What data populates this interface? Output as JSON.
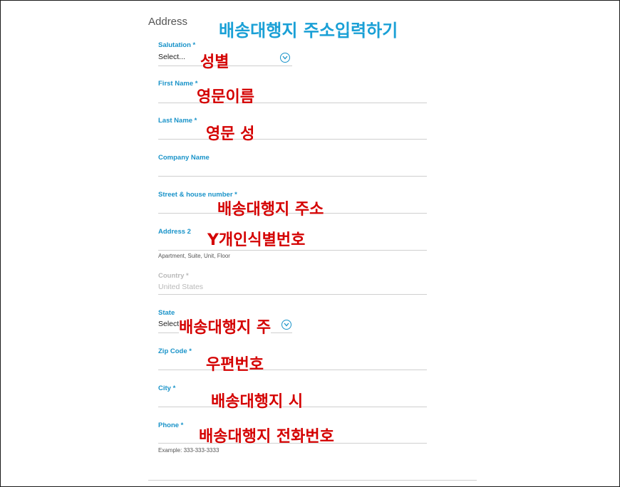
{
  "section": {
    "title": "Address",
    "heading_annotation": "배송대행지 주소입력하기"
  },
  "fields": {
    "salutation": {
      "label": "Salutation *",
      "value": "Select...",
      "annotation": "성별"
    },
    "first_name": {
      "label": "First Name *",
      "annotation": "영문이름"
    },
    "last_name": {
      "label": "Last Name *",
      "annotation": "영문 성"
    },
    "company": {
      "label": "Company Name"
    },
    "street": {
      "label": "Street & house number *",
      "annotation": "배송대행지 주소"
    },
    "address2": {
      "label": "Address 2",
      "annotation": "Y개인식별번호",
      "help": "Apartment, Suite, Unit, Floor"
    },
    "country": {
      "label": "Country *",
      "value": "United States"
    },
    "state": {
      "label": "State",
      "value": "Select",
      "annotation": "배송대행지 주"
    },
    "zip": {
      "label": "Zip Code *",
      "annotation": "우편번호"
    },
    "city": {
      "label": "City *",
      "annotation": "배송대행지 시"
    },
    "phone": {
      "label": "Phone *",
      "annotation": "배송대행지 전화번호",
      "help": "Example: 333-333-3333"
    }
  },
  "colors": {
    "label": "#1993c9",
    "annotation_red": "#d40000",
    "annotation_blue": "#1aa0d6"
  },
  "icons": {
    "dropdown": "chevron-down-icon"
  }
}
